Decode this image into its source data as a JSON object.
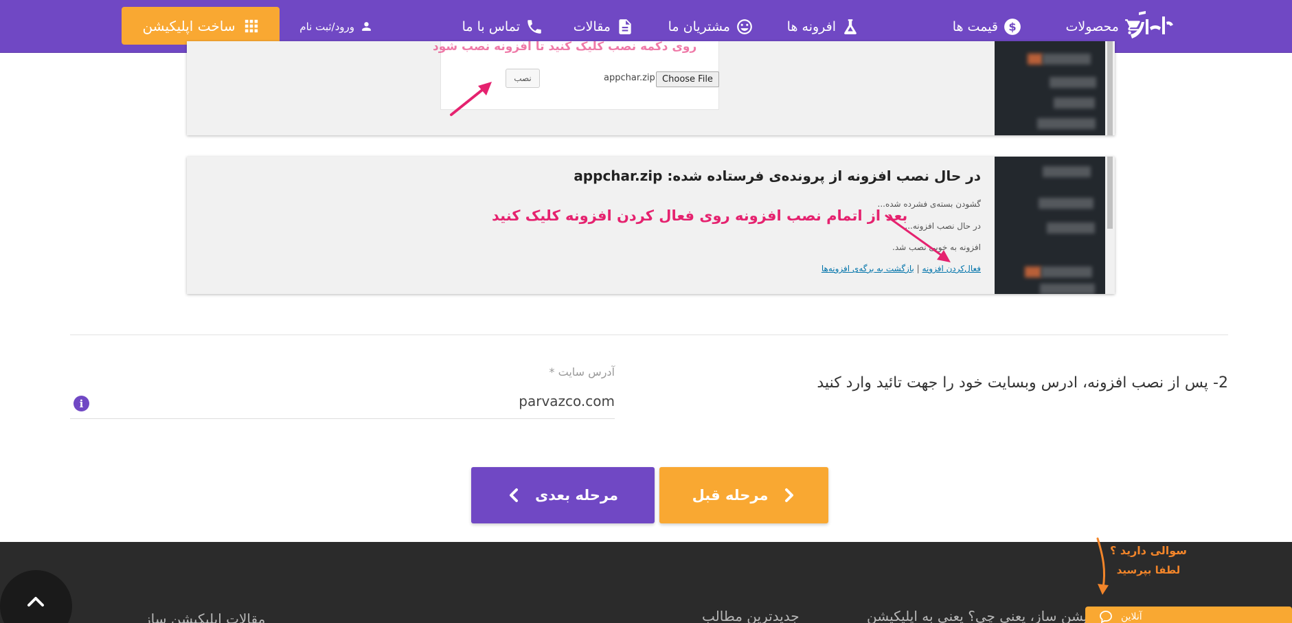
{
  "header": {
    "nav": [
      {
        "key": "products",
        "label": "محصولات",
        "icon": "cart-icon"
      },
      {
        "key": "prices",
        "label": "قیمت ها",
        "icon": "dollar-icon"
      },
      {
        "key": "plugins",
        "label": "افرونه ها",
        "icon": "flask-icon"
      },
      {
        "key": "customers",
        "label": "مشتریان ما",
        "icon": "smile-icon"
      },
      {
        "key": "articles",
        "label": "مقالات",
        "icon": "document-icon"
      },
      {
        "key": "contact",
        "label": "تماس با ما",
        "icon": "phone-icon"
      }
    ],
    "login_label": "ورود/ثبت نام",
    "build_app_label": "ساخت اپلیکیشن"
  },
  "panel1": {
    "red_text": "روی دکمه نصب کلیک کنید تا افزونه نصب شود",
    "install_button": "نصب",
    "file_name": "appchar.zip",
    "choose_file": "Choose File"
  },
  "panel2": {
    "title": "در حال نصب افزونه از پرونده‌ی فرستاده شده: appchar.zip",
    "line1": "گشودن بسته‌ی فشرده شده...",
    "line2": "در حال نصب افزونه...",
    "line3": "افزونه به خوبی نصب شد.",
    "activate_link": "فعال‌کردن افزونه",
    "separator": "|",
    "back_link": "بازگشت به برگه‌ی افزونه‌ها",
    "red_instruction": "بعد از اتمام نصب افزونه روی فعال کردن افزونه کلیک کنید"
  },
  "form": {
    "step_text": "2- پس از نصب افزونه، ادرس وبسایت خود را جهت تائید وارد کنید",
    "field_label": "آدرس سایت *",
    "field_value": "parvazco.com"
  },
  "buttons": {
    "next": "مرحله بعدی",
    "prev": "مرحله قبل"
  },
  "footer": {
    "text_left": "مقالات اپلیکیشن ساز",
    "text_mid": "جدیدترین مطالب",
    "text_right": "اپلیکیشن ساز، یعنی چی؟ یعنی به اپلیکیشن",
    "question_line1": "سوالی دارید ؟",
    "question_line2": "لطفا بپرسید",
    "chat_label": "آنلاین"
  },
  "colors": {
    "brand_purple": "#7048c4",
    "accent_orange": "#f9a832",
    "annotation_pink": "#e5226f",
    "footer_bg": "#2b2b2b"
  }
}
